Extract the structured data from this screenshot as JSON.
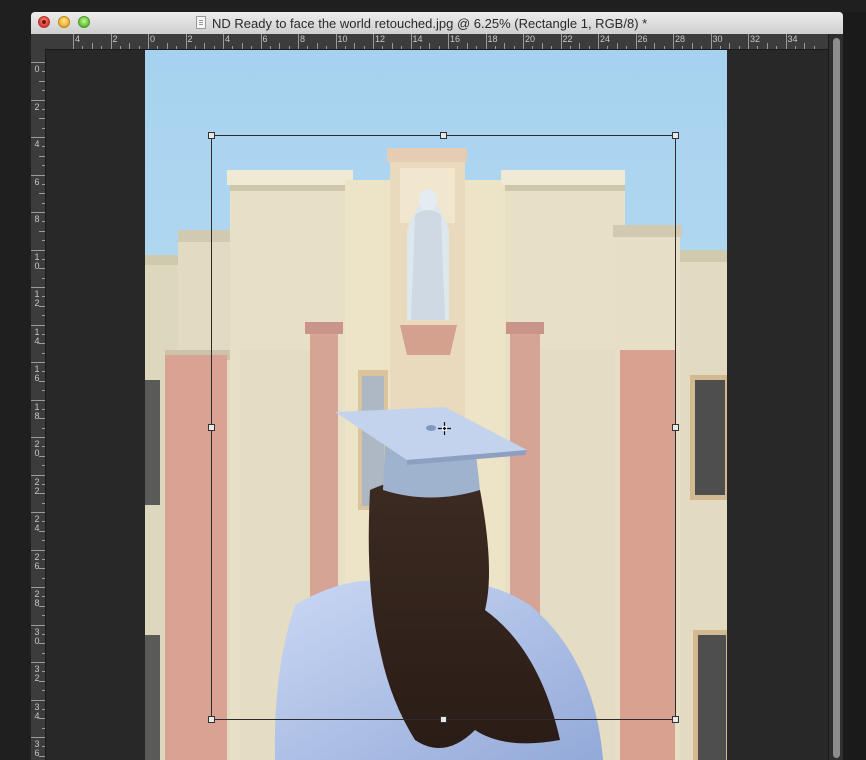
{
  "window": {
    "title": "ND Ready to face the world retouched.jpg @ 6.25% (Rectangle 1, RGB/8) *"
  },
  "ruler_top": {
    "labels": [
      "4",
      "2",
      "0",
      "2",
      "4",
      "6",
      "8",
      "10",
      "12",
      "14",
      "16",
      "18",
      "20",
      "22",
      "24",
      "26",
      "28",
      "30",
      "32",
      "34"
    ]
  },
  "ruler_left": {
    "labels": [
      "0",
      "2",
      "4",
      "6",
      "8",
      "10",
      "12",
      "14",
      "16",
      "18",
      "20",
      "22",
      "24",
      "26",
      "28",
      "30",
      "32",
      "34",
      "36"
    ]
  },
  "photo": {
    "subject": "graduate-in-cap-and-gown",
    "colors": {
      "sky": "#a9d3ee",
      "building": "#e6dfc6",
      "pillar": "#d6a595",
      "gown": "#b7c8ec",
      "hair": "#3a2a20"
    }
  },
  "icons": [
    "close-icon",
    "minimize-icon",
    "zoom-icon",
    "document-icon",
    "move-cursor-icon"
  ]
}
